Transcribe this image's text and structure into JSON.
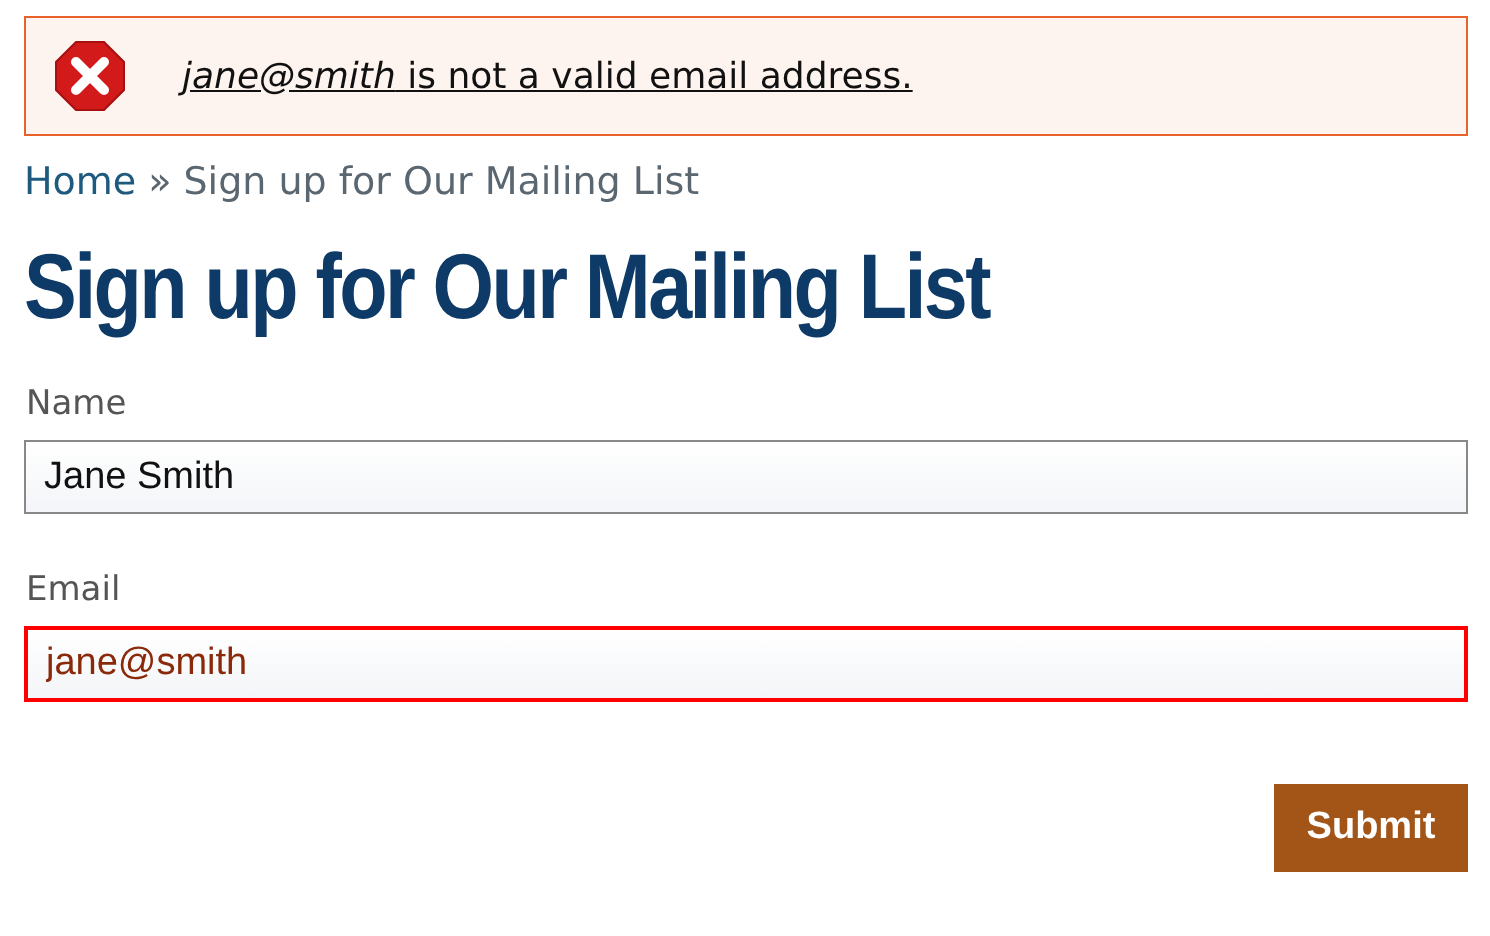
{
  "alert": {
    "message": "*jane@smith* is not a valid email address."
  },
  "breadcrumb": {
    "home": "Home",
    "separator": "»",
    "current": "Sign up for Our Mailing List"
  },
  "title": "Sign up for Our Mailing List",
  "fields": [
    {
      "label": "Name",
      "value": "Jane Smith",
      "invalid": false
    },
    {
      "label": "Email",
      "value": "jane@smith",
      "invalid": true
    }
  ],
  "submit": "Submit"
}
